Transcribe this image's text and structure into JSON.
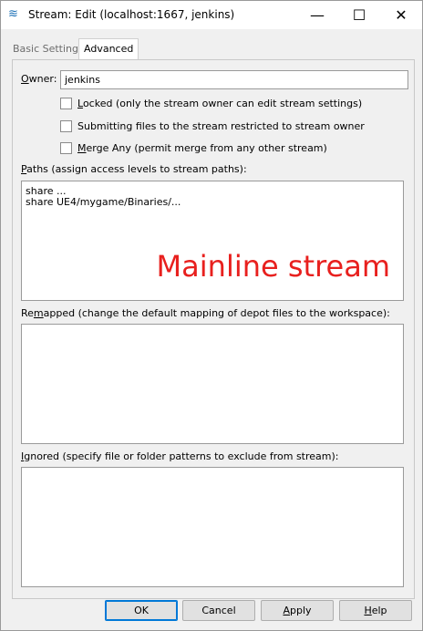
{
  "window": {
    "title": "Stream: Edit (localhost:1667,  jenkins)",
    "icon": "stream-icon",
    "minimize_glyph": "—",
    "maximize_glyph": "☐",
    "close_glyph": "✕"
  },
  "tabs": [
    {
      "label": "Basic Settings",
      "active": false
    },
    {
      "label": "Advanced",
      "active": true
    }
  ],
  "owner": {
    "label_first": "O",
    "label_rest": "wner:",
    "value": "jenkins"
  },
  "options": [
    {
      "key_letter": "L",
      "text_rest": "ocked (only the stream owner can edit stream settings)",
      "checked": false
    },
    {
      "key_letter": "",
      "text_rest": "Submitting files to the stream restricted to stream owner",
      "checked": false
    },
    {
      "key_letter": "M",
      "text_rest": "erge Any (permit merge from any other stream)",
      "checked": false
    }
  ],
  "paths": {
    "label_first": "P",
    "label_rest": "aths (assign access levels to stream paths):",
    "lines": [
      "share ...",
      "share UE4/mygame/Binaries/..."
    ],
    "overlay": "Mainline stream",
    "overlay_color": "#e8201e"
  },
  "remapped": {
    "label_pre": "Re",
    "label_key": "m",
    "label_post": "apped (change the default mapping of depot files to the workspace):"
  },
  "ignored": {
    "label_first": "I",
    "label_rest": "gnored (specify file or folder patterns to exclude from stream):"
  },
  "buttons": {
    "ok": "OK",
    "cancel": "Cancel",
    "apply_key": "A",
    "apply_rest": "pply",
    "help_key": "H",
    "help_rest": "elp"
  },
  "colors": {
    "accent": "#0078d7",
    "background": "#f0f0f0"
  }
}
